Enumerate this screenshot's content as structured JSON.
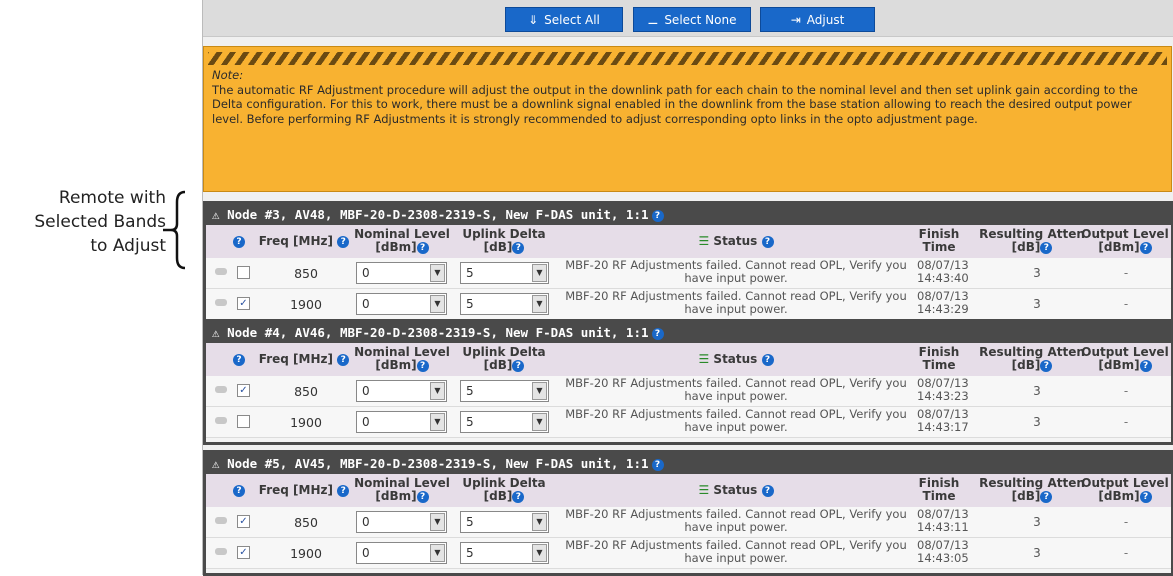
{
  "callout": {
    "lines": [
      "Remote with",
      "Selected Bands",
      "to Adjust"
    ]
  },
  "toolbar": {
    "select_all": "Select All",
    "select_none": "Select None",
    "adjust": "Adjust"
  },
  "note": {
    "title": "Note:",
    "text": "The automatic RF Adjustment procedure will adjust the output in the downlink path for each chain to the nominal level and then set uplink gain according to the Delta configuration. For this to work, there must be a downlink signal enabled in the downlink from the base station allowing to reach the desired output power level. Before performing RF Adjustments it is strongly recommended to adjust corresponding opto links in the opto adjustment page."
  },
  "columns": {
    "freq": "Freq [MHz]",
    "nominal_1": "Nominal Level",
    "nominal_2": "[dBm]",
    "uplink_1": "Uplink Delta",
    "uplink_2": "[dB]",
    "status": "Status",
    "finish_1": "Finish",
    "finish_2": "Time",
    "atten_1": "Resulting Atten",
    "atten_2": "[dB]",
    "output_1": "Output Level",
    "output_2": "[dBm]"
  },
  "nodes": [
    {
      "title": "Node #3, AV48, MBF-20-D-2308-2319-S, New F-DAS unit, 1:1",
      "rows": [
        {
          "checked": false,
          "freq": "850",
          "nominal": "0",
          "uplink": "5",
          "status": "MBF-20 RF Adjustments failed. Cannot read OPL, Verify you have input power.",
          "date": "08/07/13",
          "time": "14:43:40",
          "atten": "3",
          "output": "-"
        },
        {
          "checked": true,
          "freq": "1900",
          "nominal": "0",
          "uplink": "5",
          "status": "MBF-20 RF Adjustments failed. Cannot read OPL, Verify you have input power.",
          "date": "08/07/13",
          "time": "14:43:29",
          "atten": "3",
          "output": "-"
        }
      ]
    },
    {
      "title": "Node #4, AV46, MBF-20-D-2308-2319-S, New F-DAS unit, 1:1",
      "rows": [
        {
          "checked": true,
          "freq": "850",
          "nominal": "0",
          "uplink": "5",
          "status": "MBF-20 RF Adjustments failed. Cannot read OPL, Verify you have input power.",
          "date": "08/07/13",
          "time": "14:43:23",
          "atten": "3",
          "output": "-"
        },
        {
          "checked": false,
          "freq": "1900",
          "nominal": "0",
          "uplink": "5",
          "status": "MBF-20 RF Adjustments failed. Cannot read OPL, Verify you have input power.",
          "date": "08/07/13",
          "time": "14:43:17",
          "atten": "3",
          "output": "-"
        }
      ]
    },
    {
      "title": "Node #5, AV45, MBF-20-D-2308-2319-S, New F-DAS unit, 1:1",
      "rows": [
        {
          "checked": true,
          "freq": "850",
          "nominal": "0",
          "uplink": "5",
          "status": "MBF-20 RF Adjustments failed. Cannot read OPL, Verify you have input power.",
          "date": "08/07/13",
          "time": "14:43:11",
          "atten": "3",
          "output": "-"
        },
        {
          "checked": true,
          "freq": "1900",
          "nominal": "0",
          "uplink": "5",
          "status": "MBF-20 RF Adjustments failed. Cannot read OPL, Verify you have input power.",
          "date": "08/07/13",
          "time": "14:43:05",
          "atten": "3",
          "output": "-"
        }
      ]
    }
  ],
  "colors": {
    "accent": "#1968c9",
    "note_bg": "#f8b231",
    "header_bg": "#4a4a4a",
    "colhead_bg": "#e6dde8"
  }
}
